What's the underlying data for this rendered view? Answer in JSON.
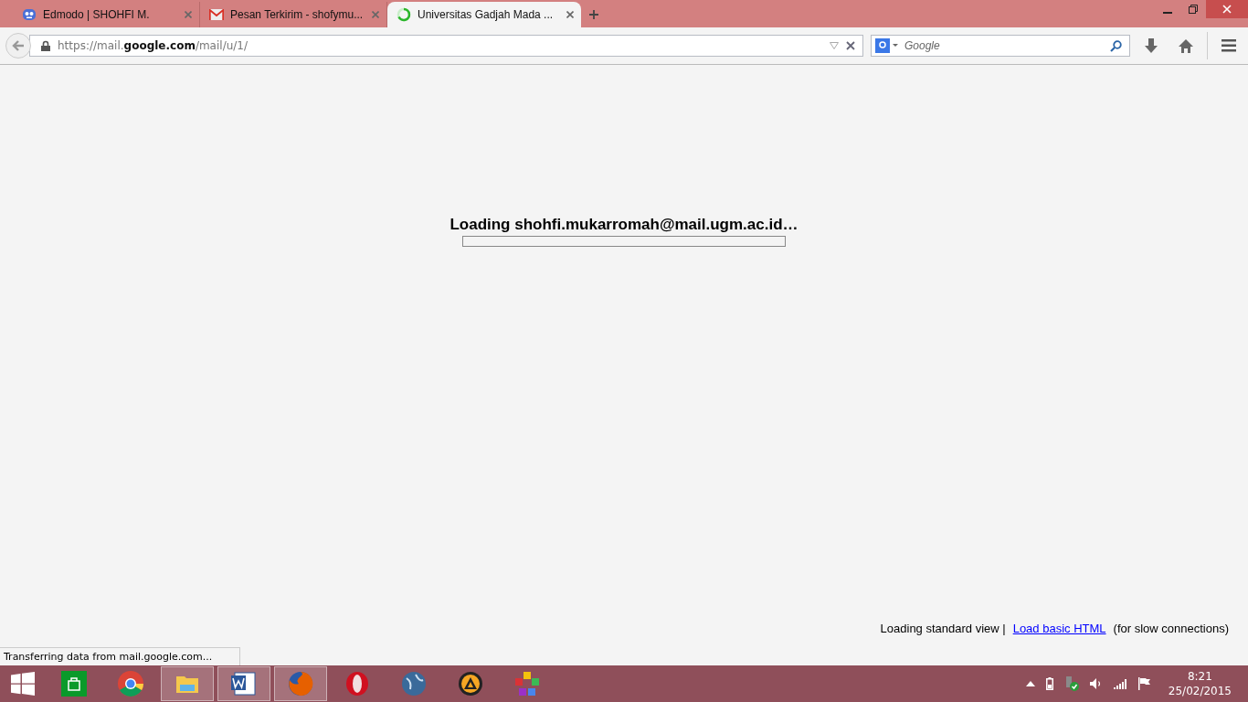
{
  "tabs": [
    {
      "title": "Edmodo | SHOHFI M.",
      "selected": false
    },
    {
      "title": "Pesan Terkirim - shofymu...",
      "selected": false
    },
    {
      "title": "Universitas Gadjah Mada ...",
      "selected": true
    }
  ],
  "address_bar": {
    "url": "https://mail.**google.com**/mail/u/1/"
  },
  "search": {
    "placeholder": "Google"
  },
  "page": {
    "loading_title": "Loading shohfi.mukarromah@mail.ugm.ac.id…",
    "progress": {
      "level": 0
    },
    "footer": {
      "prefix": "Loading standard view |",
      "link": "Load basic HTML",
      "suffix": "(for slow connections)"
    }
  },
  "status_bar": {
    "text": "Transferring data from mail.google.com..."
  },
  "taskbar": {
    "apps": [
      {
        "running": false
      },
      {
        "running": false
      },
      {
        "running": true
      },
      {
        "running": true
      },
      {
        "running": true
      },
      {
        "running": false
      },
      {
        "running": false
      },
      {
        "running": false
      },
      {
        "running": false
      }
    ],
    "time": "8:21",
    "date": "25/02/2015"
  }
}
